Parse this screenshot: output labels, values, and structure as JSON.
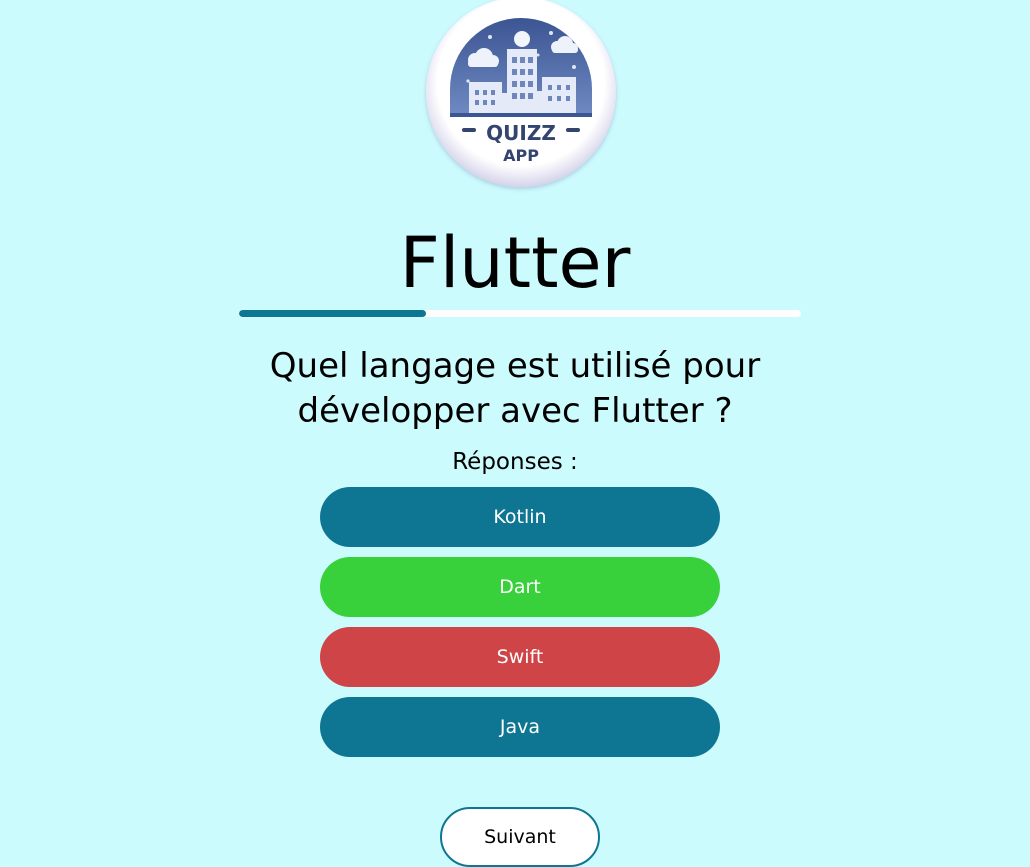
{
  "logo": {
    "line1": "QUIZZ",
    "line2": "APP"
  },
  "quiz": {
    "title": "Flutter",
    "progress": 0.333,
    "question": "Quel langage est utilisé pour développer avec Flutter ?",
    "answers_label": "Réponses :",
    "answers": [
      {
        "label": "Kotlin",
        "state": "default"
      },
      {
        "label": "Dart",
        "state": "correct"
      },
      {
        "label": "Swift",
        "state": "wrong"
      },
      {
        "label": "Java",
        "state": "default"
      }
    ],
    "next_label": "Suivant"
  },
  "colors": {
    "background": "#ccfbfe",
    "primary": "#0e7692",
    "correct": "#38d03b",
    "wrong": "#cf4447"
  }
}
